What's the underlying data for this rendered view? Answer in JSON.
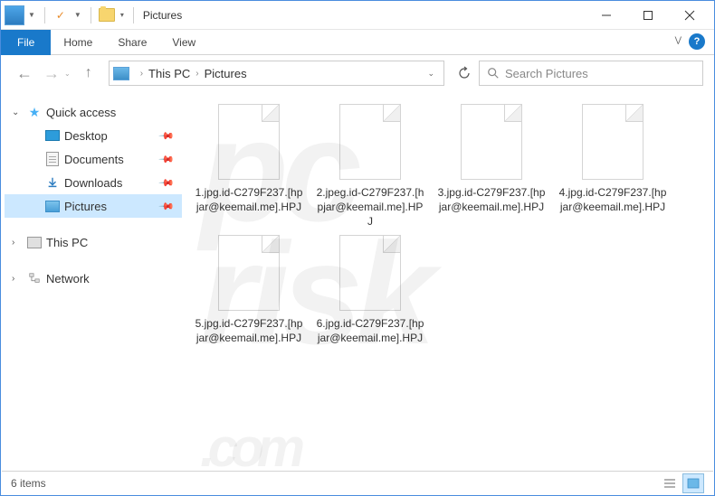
{
  "titlebar": {
    "title": "Pictures"
  },
  "ribbon": {
    "file": "File",
    "tabs": [
      "Home",
      "Share",
      "View"
    ]
  },
  "breadcrumb": {
    "parts": [
      "This PC",
      "Pictures"
    ]
  },
  "search": {
    "placeholder": "Search Pictures"
  },
  "sidebar": {
    "quick_access": "Quick access",
    "items": [
      "Desktop",
      "Documents",
      "Downloads",
      "Pictures"
    ],
    "this_pc": "This PC",
    "network": "Network"
  },
  "files": [
    "1.jpg.id-C279F237.[hpjar@keemail.me].HPJ",
    "2.jpeg.id-C279F237.[hpjar@keemail.me].HPJ",
    "3.jpg.id-C279F237.[hpjar@keemail.me].HPJ",
    "4.jpg.id-C279F237.[hpjar@keemail.me].HPJ",
    "5.jpg.id-C279F237.[hpjar@keemail.me].HPJ",
    "6.jpg.id-C279F237.[hpjar@keemail.me].HPJ"
  ],
  "statusbar": {
    "count": "6 items"
  },
  "watermark": "pc\nrisk\n.com"
}
